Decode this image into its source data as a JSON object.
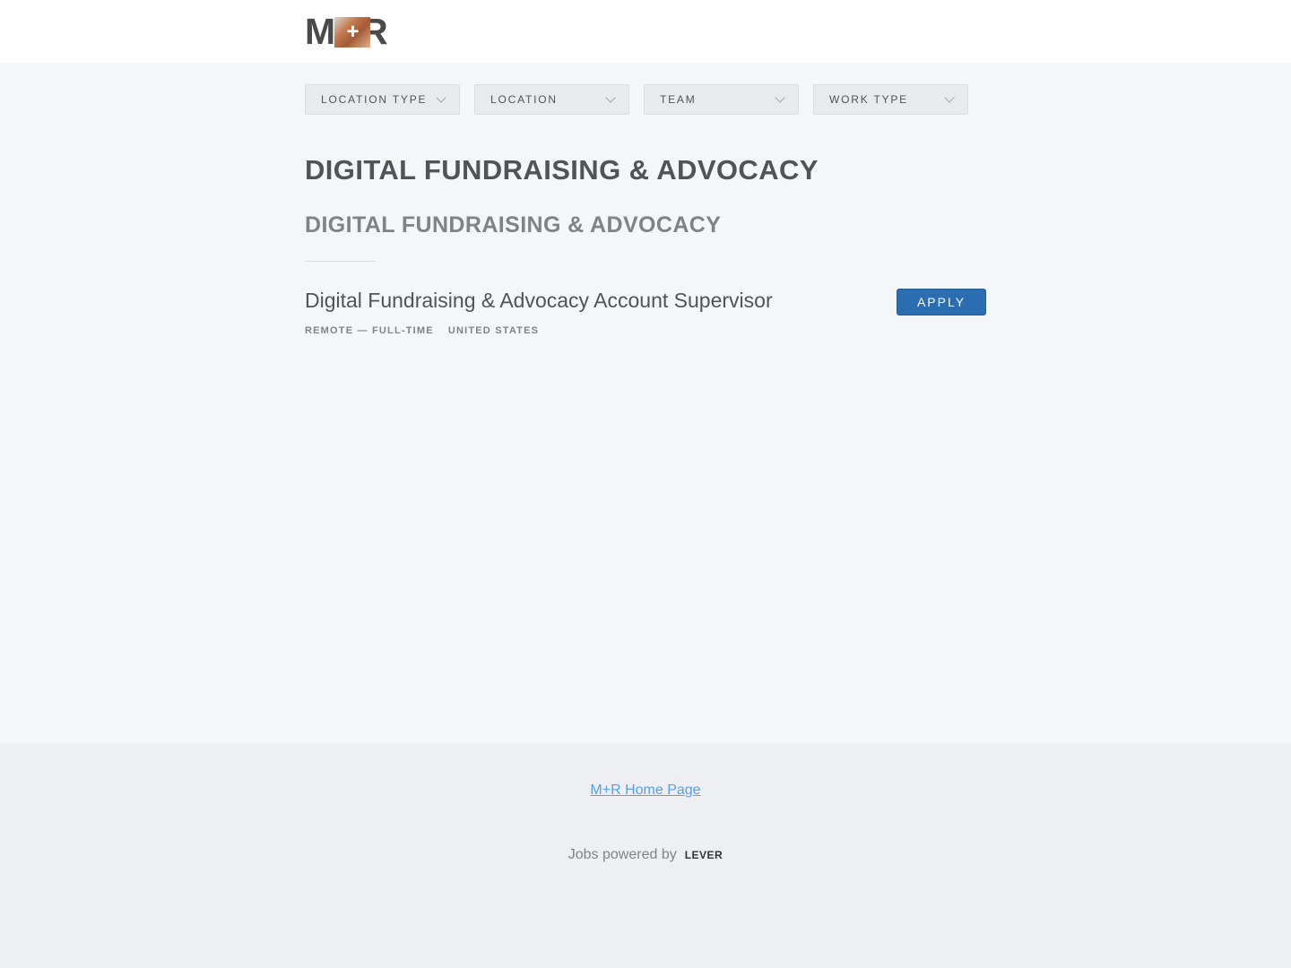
{
  "header": {
    "logo": {
      "left": "M",
      "plus": "+",
      "right": "R"
    }
  },
  "filters": [
    {
      "label": "LOCATION TYPE"
    },
    {
      "label": "LOCATION"
    },
    {
      "label": "TEAM"
    },
    {
      "label": "WORK TYPE"
    }
  ],
  "team": {
    "title": "DIGITAL FUNDRAISING & ADVOCACY",
    "subteam": "DIGITAL FUNDRAISING & ADVOCACY"
  },
  "posting": {
    "title": "Digital Fundraising & Advocacy Account Supervisor",
    "commitment": "REMOTE — FULL-TIME",
    "location": "UNITED STATES",
    "apply_label": "APPLY"
  },
  "footer": {
    "home_link": "M+R Home Page",
    "powered_by": "Jobs powered by",
    "lever_logo": "LEVER"
  },
  "colors": {
    "accent": "#2a6db0",
    "link": "#579eee",
    "background": "#f5f6f7",
    "footer_background": "#eeeff2"
  }
}
